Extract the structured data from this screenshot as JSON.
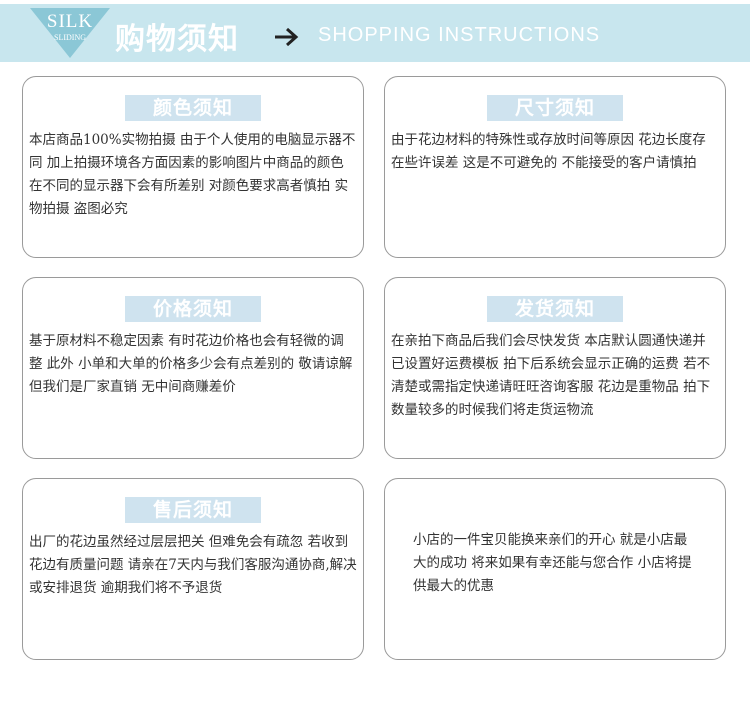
{
  "header": {
    "logo_text": "SILK",
    "logo_subtext": "SLIDING",
    "title": "购物须知",
    "arrow_icon": "arrow-right-icon",
    "subtitle": "SHOPPING INSTRUCTIONS",
    "banner_color": "#c8e6ee",
    "accent_color": "#8bc7d6"
  },
  "cards": [
    {
      "title": "颜色须知",
      "text": "本店商品100%实物拍摄 由于个人使用的电脑显示器不同 加上拍摄环境各方面因素的影响图片中商品的颜色在不同的显示器下会有所差别 对颜色要求高者慎拍 实物拍摄 盗图必究"
    },
    {
      "title": "尺寸须知",
      "text": "由于花边材料的特殊性或存放时间等原因 花边长度存在些许误差 这是不可避免的 不能接受的客户请慎拍"
    },
    {
      "title": "价格须知",
      "text": "基于原材料不稳定因素 有时花边价格也会有轻微的调整 此外 小单和大单的价格多少会有点差别的 敬请谅解 但我们是厂家直销 无中间商赚差价"
    },
    {
      "title": "发货须知",
      "text": "在亲拍下商品后我们会尽快发货 本店默认圆通快递并已设置好运费模板 拍下后系统会显示正确的运费 若不清楚或需指定快递请旺旺咨询客服 花边是重物品 拍下数量较多的时候我们将走货运物流"
    },
    {
      "title": "售后须知",
      "text": "出厂的花边虽然经过层层把关 但难免会有疏忽 若收到花边有质量问题 请亲在7天内与我们客服沟通协商,解决或安排退货 逾期我们将不予退货"
    },
    {
      "title": "",
      "text": "小店的一件宝贝能换来亲们的开心 就是小店最大的成功 将来如果有幸还能与您合作 小店将提供最大的优惠"
    }
  ]
}
